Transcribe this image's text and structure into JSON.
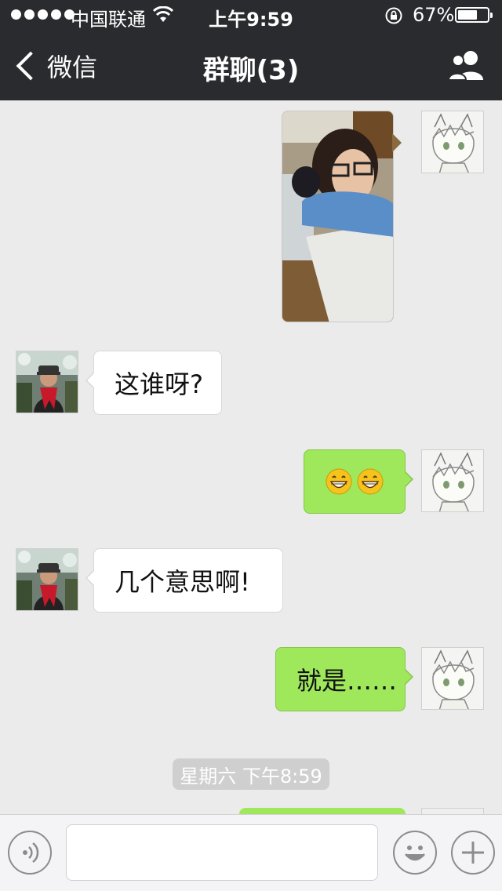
{
  "status_bar": {
    "carrier": "中国联通",
    "time": "上午9:59",
    "battery_percent": "67%",
    "battery_level": 0.67,
    "signal_bars": 5
  },
  "nav": {
    "back_label": "微信",
    "title": "群聊(3)",
    "group_icon": "group-members-icon"
  },
  "messages": [
    {
      "side": "out",
      "type": "image",
      "sender_avatar": "anime-avatar"
    },
    {
      "side": "in",
      "type": "text",
      "text": "这谁呀?",
      "sender_avatar": "person-avatar"
    },
    {
      "side": "out",
      "type": "emoji",
      "emojis": [
        "😁",
        "😁"
      ],
      "sender_avatar": "anime-avatar"
    },
    {
      "side": "in",
      "type": "text",
      "text": "几个意思啊!",
      "sender_avatar": "person-avatar"
    },
    {
      "side": "out",
      "type": "text",
      "text": "就是……",
      "sender_avatar": "anime-avatar"
    }
  ],
  "timestamp": "星期六 下午8:59",
  "input_bar": {
    "voice_icon": "voice-icon",
    "emoji_icon": "emoji-icon",
    "add_icon": "plus-icon",
    "text_value": ""
  },
  "colors": {
    "nav_bg": "#2a2b2f",
    "chat_bg": "#ebebeb",
    "bubble_out": "#9fe75b",
    "bubble_in": "#ffffff"
  }
}
